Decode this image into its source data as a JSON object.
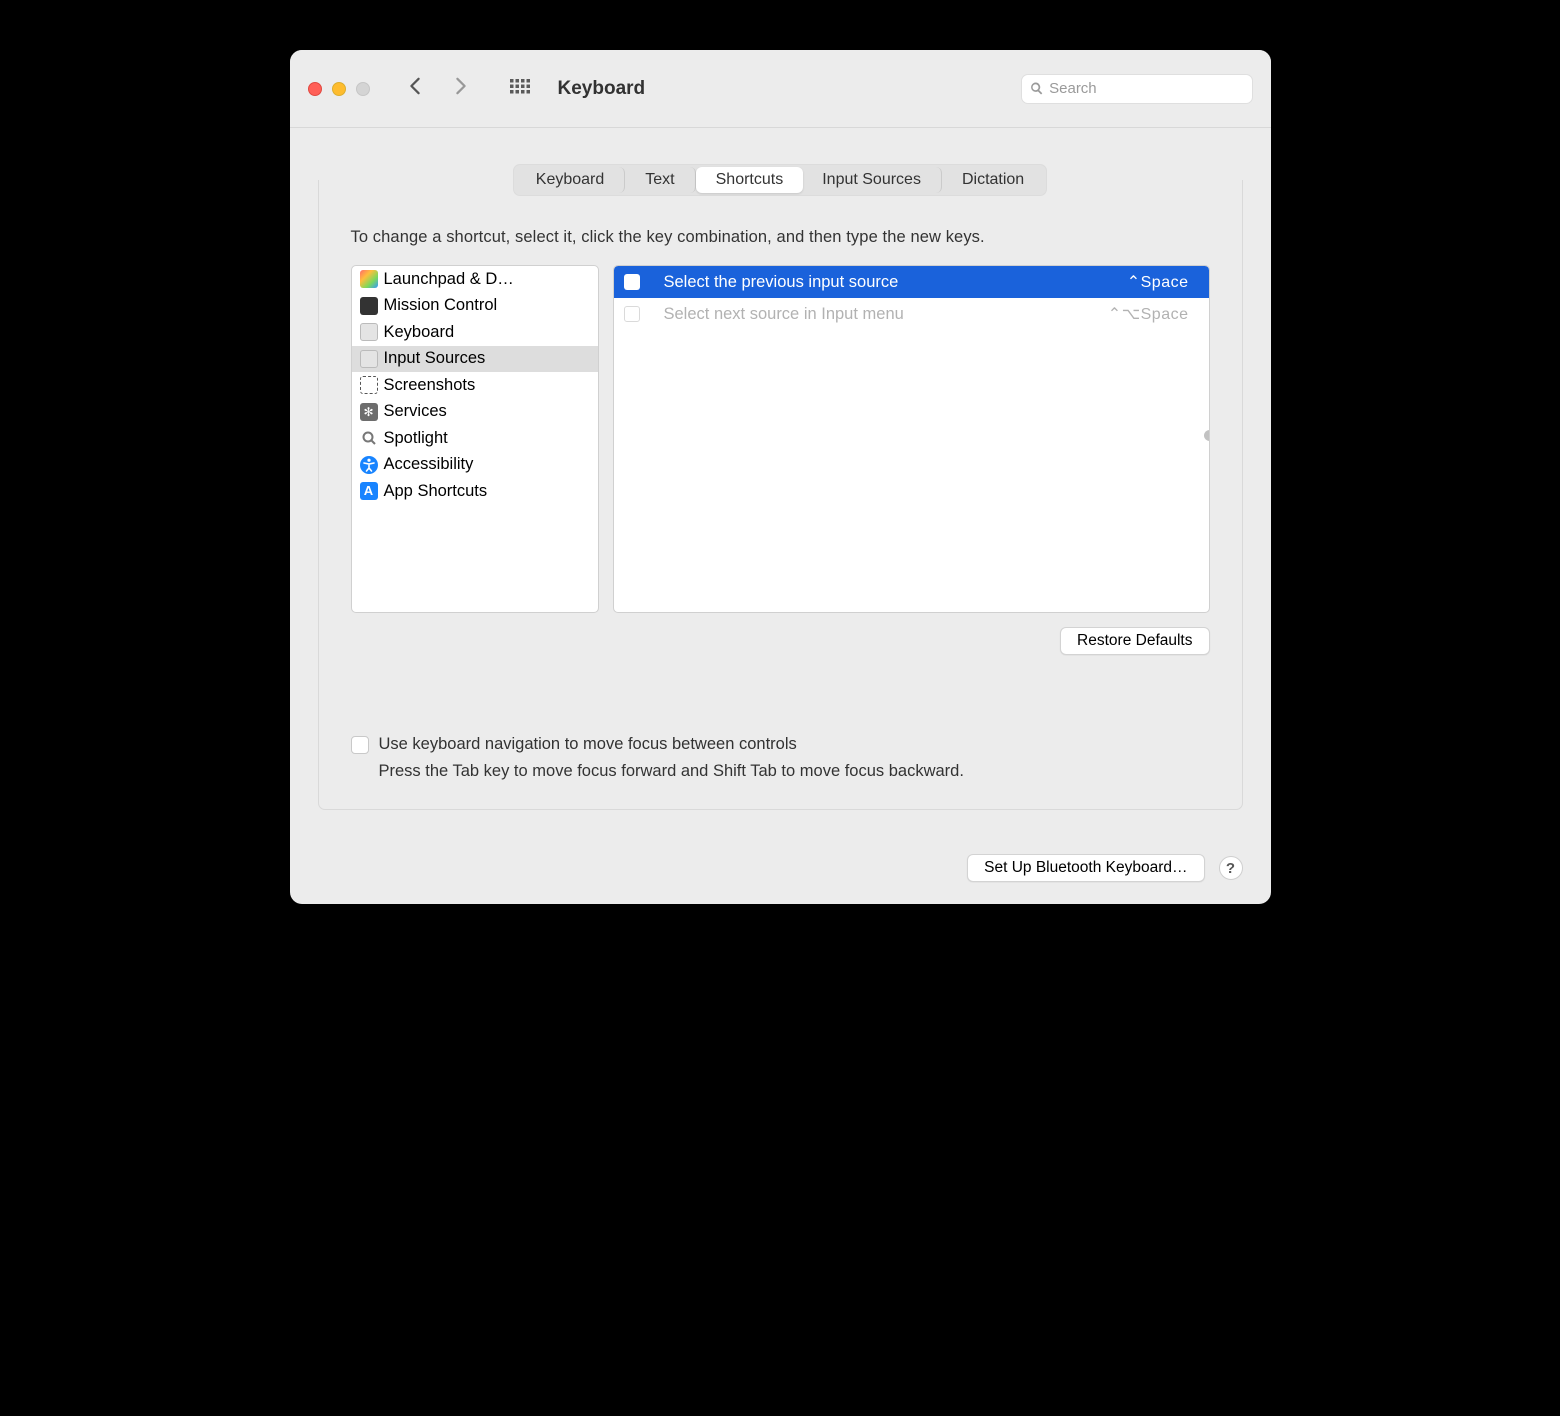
{
  "window": {
    "title": "Keyboard",
    "search_placeholder": "Search"
  },
  "tabs": [
    {
      "label": "Keyboard"
    },
    {
      "label": "Text"
    },
    {
      "label": "Shortcuts",
      "active": true
    },
    {
      "label": "Input Sources"
    },
    {
      "label": "Dictation"
    }
  ],
  "instructions": "To change a shortcut, select it, click the key combination, and then type the new keys.",
  "categories": [
    {
      "label": "Launchpad & D…",
      "icon": "launchpad"
    },
    {
      "label": "Mission Control",
      "icon": "mission-control"
    },
    {
      "label": "Keyboard",
      "icon": "keyboard"
    },
    {
      "label": "Input Sources",
      "icon": "keyboard",
      "selected": true
    },
    {
      "label": "Screenshots",
      "icon": "screenshot"
    },
    {
      "label": "Services",
      "icon": "services"
    },
    {
      "label": "Spotlight",
      "icon": "spotlight"
    },
    {
      "label": "Accessibility",
      "icon": "accessibility"
    },
    {
      "label": "App Shortcuts",
      "icon": "app-shortcuts"
    }
  ],
  "shortcuts": [
    {
      "label": "Select the previous input source",
      "keys": "⌃Space",
      "checked": false,
      "selected": true
    },
    {
      "label": "Select next source in Input menu",
      "keys": "⌃⌥Space",
      "checked": false,
      "disabled": true
    }
  ],
  "buttons": {
    "restore_defaults": "Restore Defaults",
    "setup_bluetooth": "Set Up Bluetooth Keyboard…",
    "help": "?"
  },
  "kbnav": {
    "label": "Use keyboard navigation to move focus between controls",
    "sub": "Press the Tab key to move focus forward and Shift Tab to move focus backward."
  }
}
